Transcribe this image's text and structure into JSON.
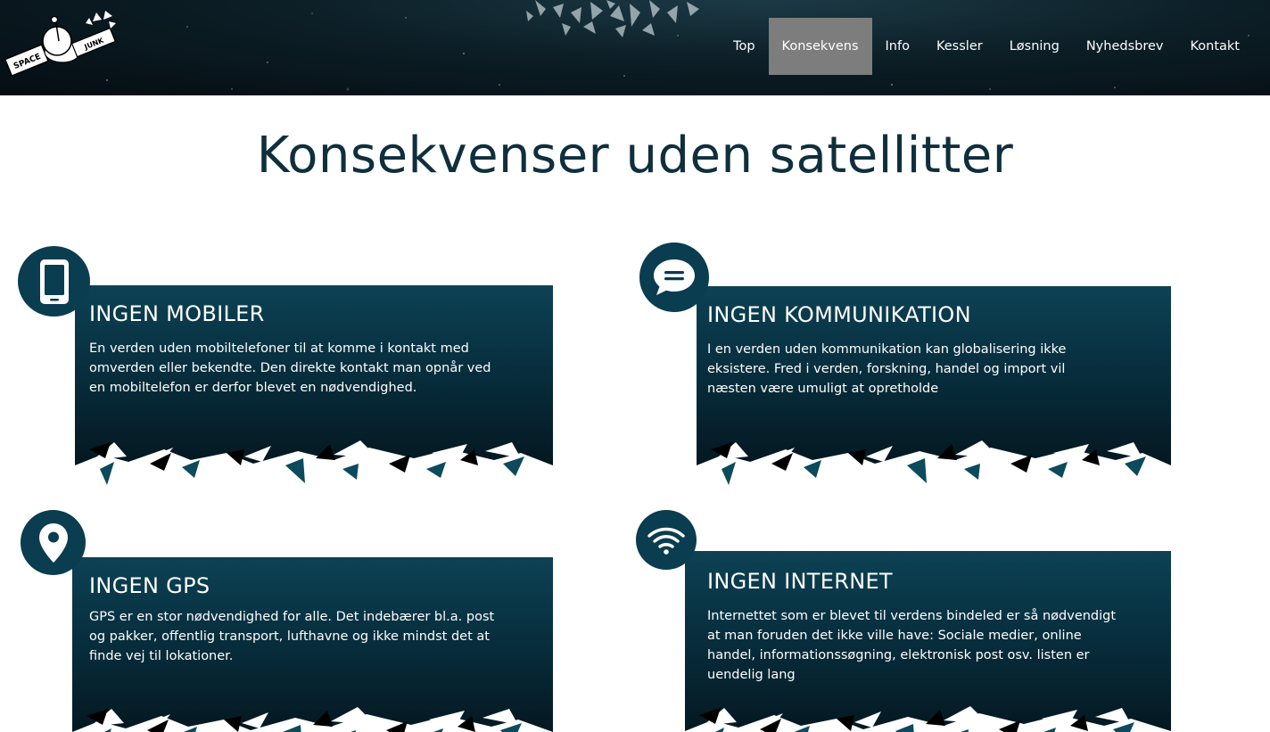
{
  "logo": {
    "line1": "SPACE",
    "line2": "JUNK"
  },
  "nav": {
    "items": [
      {
        "label": "Top"
      },
      {
        "label": "Konsekvens"
      },
      {
        "label": "Info"
      },
      {
        "label": "Kessler"
      },
      {
        "label": "Løsning"
      },
      {
        "label": "Nyhedsbrev"
      },
      {
        "label": "Kontakt"
      }
    ],
    "active": "Konsekvens"
  },
  "page_title": "Konsekvenser uden satellitter",
  "cards": [
    {
      "icon": "phone-icon",
      "heading": "INGEN MOBILER",
      "text": "En verden uden mobiltelefoner til at komme i kontakt med omverden eller bekendte. Den direkte kontakt man opnår ved en mobiltelefon er derfor blevet en nødvendighed."
    },
    {
      "icon": "chat-bubble-icon",
      "heading": "INGEN KOMMUNIKATION",
      "text": "I en verden uden kommunikation kan globalisering ikke eksistere. Fred i verden, forskning, handel og import vil næsten være umuligt at opretholde"
    },
    {
      "icon": "location-pin-icon",
      "heading": "INGEN GPS",
      "text": "GPS er en stor nødvendighed for alle. Det indebærer bl.a. post og pakker, offentlig transport, lufthavne og ikke mindst det at finde vej til lokationer."
    },
    {
      "icon": "wifi-icon",
      "heading": "INGEN INTERNET",
      "text": "Internettet som er blevet til verdens bindeled er så nødvendigt at man foruden det ikke ville have: Sociale medier, online handel, informationssøgning, elektronisk post osv. listen er uendelig lang"
    }
  ],
  "colors": {
    "header_bg": "#081820",
    "nav_active_bg": "#7d7d7d",
    "title_color": "#0f2f3d",
    "card_bg": "#083141",
    "icon_circle": "#093d4f"
  }
}
